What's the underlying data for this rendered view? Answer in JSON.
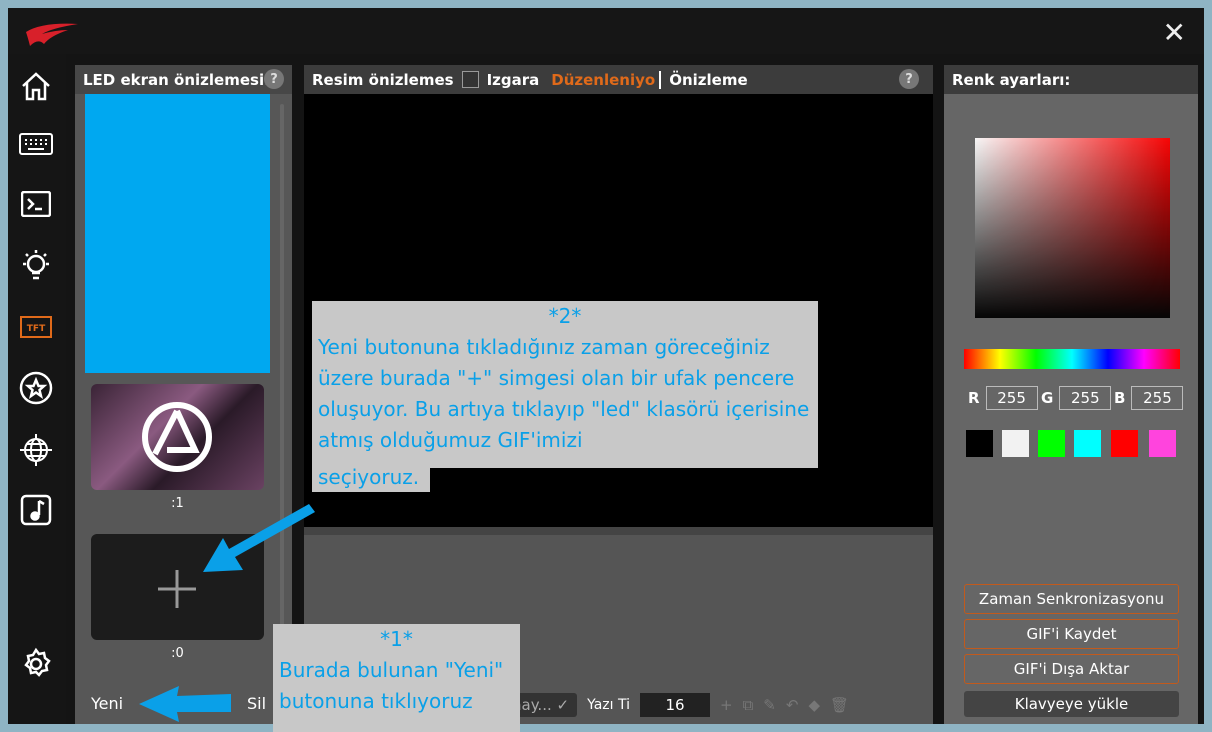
{
  "left_panel": {
    "title": "LED ekran önizlemesi:",
    "help": "?",
    "frames": [
      ":1",
      ":0"
    ],
    "new_label": "Yeni",
    "delete_label": "Sil"
  },
  "center": {
    "title": "Resim önizlemes",
    "grid_label": "Izgara",
    "editing_label": "Düzenleniyo",
    "preview_label": "Önizleme",
    "help": "?",
    "font_select": "nay...",
    "font_label": "Yazı Ti",
    "font_size": "16"
  },
  "right": {
    "title": "Renk ayarları:",
    "r_label": "R",
    "g_label": "G",
    "b_label": "B",
    "r": "255",
    "g": "255",
    "b": "255",
    "swatches": [
      "#000000",
      "#f2f2f2",
      "#00ff00",
      "#00ffff",
      "#ff0000",
      "#ff44dd"
    ],
    "buttons": [
      "Zaman Senkronizasyonu",
      "GIF'i Kaydet",
      "GIF'i Dışa Aktar",
      "Klavyeye yükle"
    ]
  },
  "annotations": {
    "a2_title": "*2*",
    "a2_text": "Yeni butonuna tıkladığınız zaman göreceğiniz üzere burada \"+\" simgesi olan bir ufak pencere oluşuyor. Bu artıya tıklayıp \"led\" klasörü içerisine atmış olduğumuz GIF'imizi",
    "a2_tail": "seçiyoruz.",
    "a1_title": "*1*",
    "a1_text": "Burada bulunan \"Yeni\" butonuna tıklıyoruz"
  },
  "colors": {
    "accent": "#e06a1a",
    "annotation": "#0aa0e8",
    "led": "#00a8f0"
  }
}
